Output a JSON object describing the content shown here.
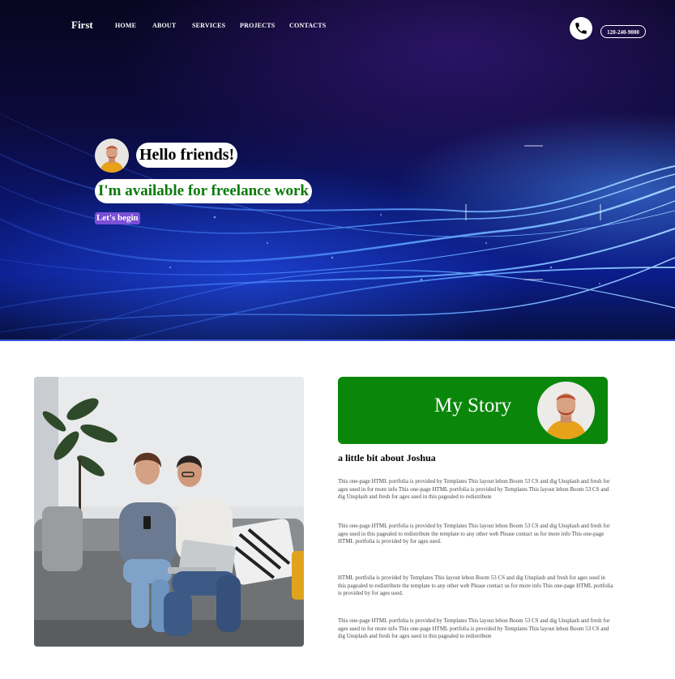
{
  "nav": {
    "logo": "First",
    "items": [
      {
        "label": "HOME"
      },
      {
        "label": "ABOUT"
      },
      {
        "label": "SERVICES"
      },
      {
        "label": "PROJECTS"
      },
      {
        "label": "CONTACTS"
      }
    ],
    "phone_icon": "phone-icon",
    "phone_number": "120-240-9000"
  },
  "hero": {
    "greeting": "Hello friends!",
    "tagline": "I'm available for freelance work",
    "cta": "Let's begin"
  },
  "about": {
    "title": "My Story",
    "subtitle": "a little bit about Joshua",
    "paragraphs": [
      "This one-page HTML portfolia is provided by Templates This layout lebon Boom 53 CS and dig Unsplash and fresh for ages used in for more info This one-page HTML portfolia is provided by Templates This layout lebon Boom 53 CS and dig Unsplash and fresh for ages used in this pagealed to redistribute",
      "This one-page HTML portfolia is provided by Templates This layout lebon Boom 53 CS and dig Unsplash and fresh for ages used in this pagealed to redistribute the template to any other web Please contact us for more info This one-page HTML portfolia is provided by for ages used.",
      "HTML portfolia is provided by Templates This layout lebon Boom 53 CS and dig Unsplash and fresh for ages used in this pagealed to redistribute the template to any other web Please contact us for more info This one-page HTML portfolia is provided by for ages used.",
      "This one-page HTML portfolia is provided by Templates This layout lebon Boom 53 CS and dig Unsplash and fresh for ages used in for more info This one-page HTML portfolia is provided by Templates This layout lebon Boom 53 CS and dig Unsplash and fresh for ages used in this pagealed to redistribute"
    ]
  },
  "colors": {
    "story_green": "#0a870a",
    "tagline_green": "#0a7a0a",
    "cta_purple": "#7b4fd6"
  }
}
